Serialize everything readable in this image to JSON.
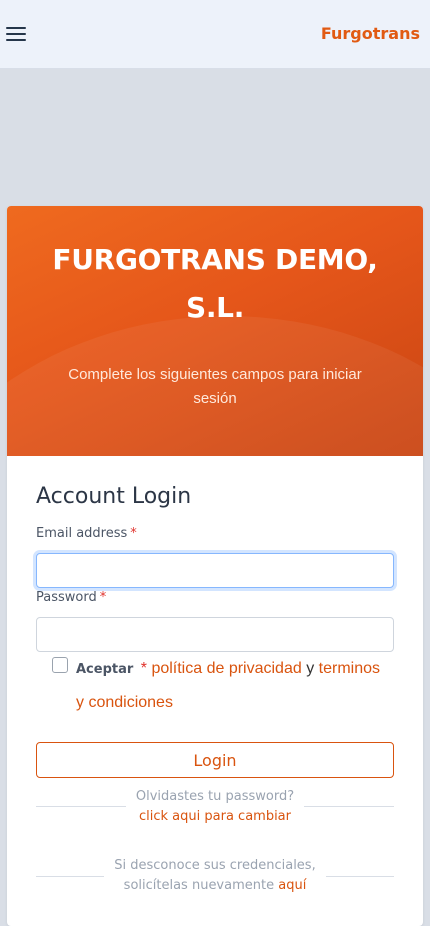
{
  "header": {
    "brand": "Furgotrans"
  },
  "hero": {
    "title_line1": "FURGOTRANS DEMO,",
    "title_line2": "S.L.",
    "subtitle_line1": "Complete los siguientes campos para iniciar",
    "subtitle_line2": "sesión"
  },
  "form": {
    "title": "Account Login",
    "email_label": "Email address",
    "password_label": "Password",
    "required_mark": "*",
    "email_value": "",
    "password_value": "",
    "accept_label": "Aceptar",
    "privacy_link": "política de privacidad",
    "and_text": "y",
    "terms_link_line1": "terminos",
    "terms_link_line2": "y condiciones",
    "login_button": "Login"
  },
  "forgot": {
    "question": "Olvidastes tu password?",
    "link": "click aqui para cambiar"
  },
  "credentials": {
    "line1": "Si desconoce sus credenciales,",
    "line2": "solicítelas nuevamente",
    "link": "aquí"
  },
  "colors": {
    "accent": "#e15a12",
    "hero_start": "#ef6a1f",
    "hero_end": "#c94513",
    "focus_ring": "#86b7fe"
  },
  "icons": {
    "menu": "hamburger-menu-icon"
  }
}
